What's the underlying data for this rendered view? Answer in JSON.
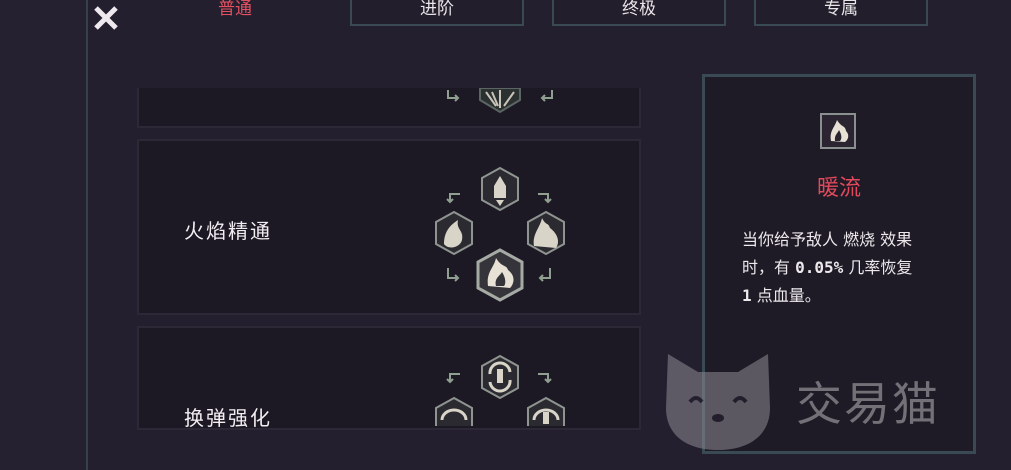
{
  "tabs": [
    {
      "label": "普通",
      "active": true
    },
    {
      "label": "进阶",
      "active": false
    },
    {
      "label": "终极",
      "active": false
    },
    {
      "label": "专属",
      "active": false
    }
  ],
  "skills": [
    {
      "label": ""
    },
    {
      "label": "火焰精通"
    },
    {
      "label": "换弹强化"
    }
  ],
  "detail": {
    "icon": "flame-icon",
    "title": "暖流",
    "line1": "当你给予敌人 燃烧 效果",
    "line2_a": "时，有 ",
    "line2_b": "0.05%",
    "line2_c": " 几率恢复",
    "line3_a": "1",
    "line3_b": " 点血量。"
  },
  "watermark": {
    "text": "交易猫"
  },
  "colors": {
    "accent": "#e04a5c",
    "border": "#3a4a55",
    "icon": "#d9d4c8"
  }
}
